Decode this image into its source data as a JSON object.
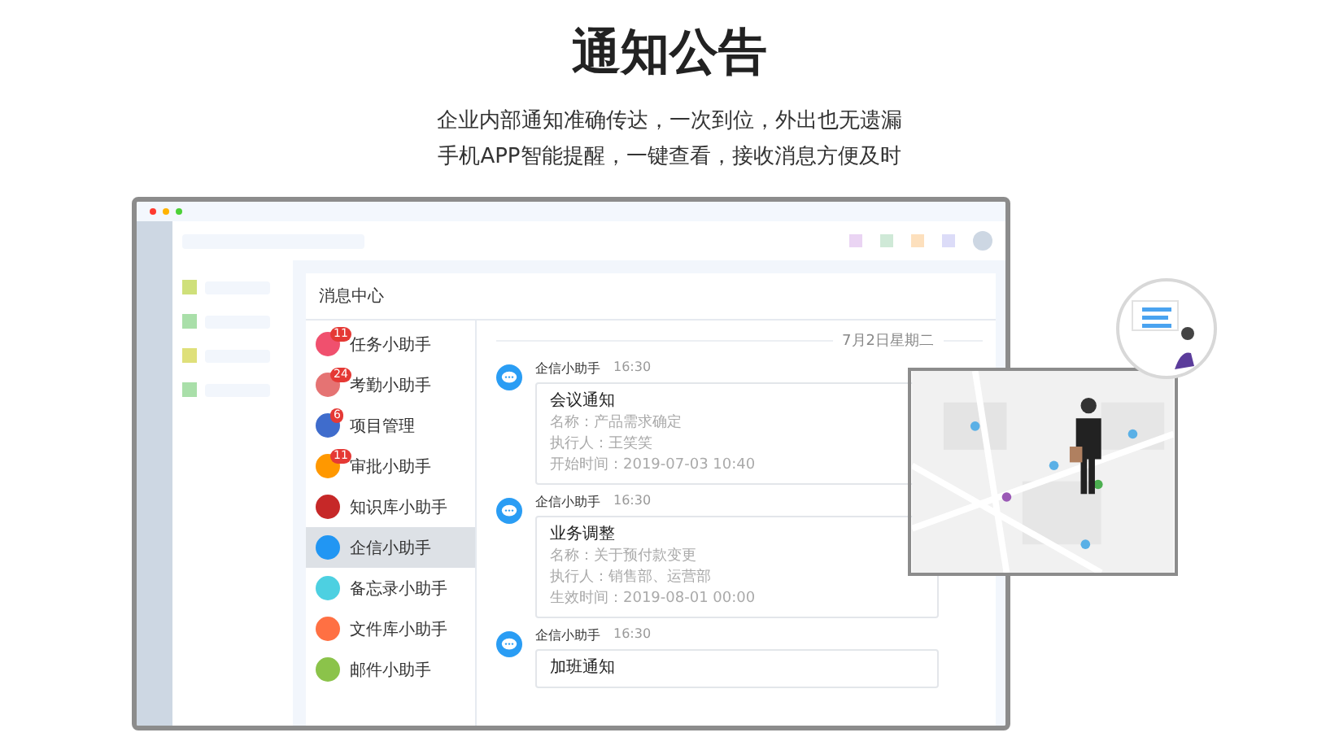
{
  "heading": {
    "title": "通知公告",
    "lines": [
      "企业内部通知准确传达，一次到位，外出也无遗漏",
      "手机APP智能提醒，一键查看，接收消息方便及时"
    ]
  },
  "app": {
    "panel_title": "消息中心",
    "assistants": [
      {
        "label": "任务小助手",
        "badge": "11",
        "color": "#f0506e",
        "selected": false
      },
      {
        "label": "考勤小助手",
        "badge": "24",
        "color": "#e57373",
        "selected": false
      },
      {
        "label": "项目管理",
        "badge": "6",
        "color": "#3f6ccc",
        "selected": false
      },
      {
        "label": "审批小助手",
        "badge": "11",
        "color": "#ff9800",
        "selected": false
      },
      {
        "label": "知识库小助手",
        "color": "#c62828",
        "selected": false
      },
      {
        "label": "企信小助手",
        "color": "#2196f3",
        "selected": true
      },
      {
        "label": "备忘录小助手",
        "color": "#4dd0e1",
        "selected": false
      },
      {
        "label": "文件库小助手",
        "color": "#ff7043",
        "selected": false
      },
      {
        "label": "邮件小助手",
        "color": "#8bc34a",
        "selected": false
      }
    ],
    "date_divider": "7月2日星期二",
    "messages": [
      {
        "sender": "企信小助手",
        "time": "16:30",
        "title": "会议通知",
        "lines": [
          "名称：产品需求确定",
          "执行人：王笑笑",
          "开始时间：2019-07-03 10:40"
        ]
      },
      {
        "sender": "企信小助手",
        "time": "16:30",
        "title": "业务调整",
        "lines": [
          "名称：关于预付款变更",
          "执行人：销售部、运营部",
          "生效时间：2019-08-01 00:00"
        ]
      },
      {
        "sender": "企信小助手",
        "time": "16:30",
        "title": "加班通知"
      }
    ]
  }
}
